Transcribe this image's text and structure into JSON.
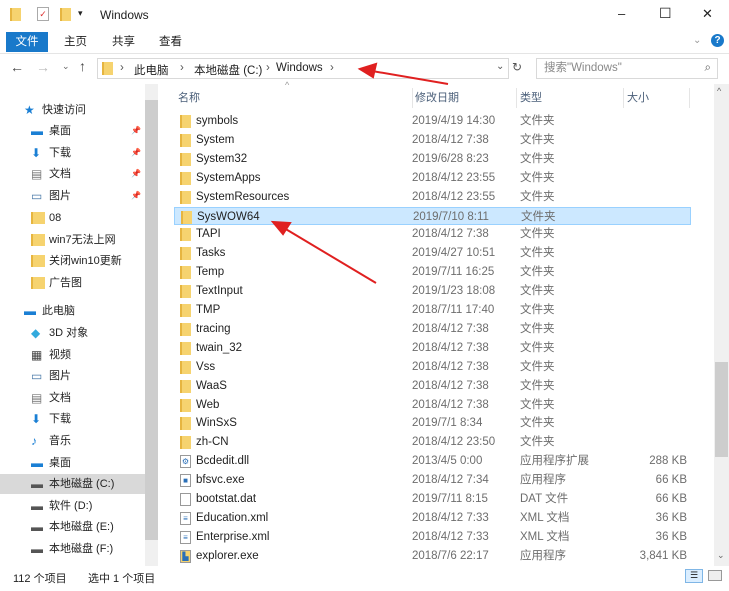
{
  "window": {
    "title": "Windows",
    "minimize": "–",
    "maximize": "☐",
    "close": "✕"
  },
  "ribbon": {
    "tabs": [
      "文件",
      "主页",
      "共享",
      "查看"
    ],
    "help": "?"
  },
  "address": {
    "crumbs": [
      "此电脑",
      "本地磁盘 (C:)",
      "Windows"
    ],
    "search_placeholder": "搜索\"Windows\""
  },
  "columns": {
    "name": "名称",
    "date": "修改日期",
    "type": "类型",
    "size": "大小"
  },
  "sidebar": {
    "quick_access": "快速访问",
    "quick_items": [
      {
        "label": "桌面",
        "icon": "desktop",
        "pinned": true
      },
      {
        "label": "下载",
        "icon": "download",
        "pinned": true
      },
      {
        "label": "文档",
        "icon": "document",
        "pinned": true
      },
      {
        "label": "图片",
        "icon": "picture",
        "pinned": true
      },
      {
        "label": "08",
        "icon": "folder"
      },
      {
        "label": "win7无法上网",
        "icon": "folder"
      },
      {
        "label": "关闭win10更新",
        "icon": "folder"
      },
      {
        "label": "广告图",
        "icon": "folder"
      }
    ],
    "this_pc": "此电脑",
    "pc_items": [
      {
        "label": "3D 对象",
        "icon": "3d"
      },
      {
        "label": "视频",
        "icon": "video"
      },
      {
        "label": "图片",
        "icon": "picture"
      },
      {
        "label": "文档",
        "icon": "document"
      },
      {
        "label": "下载",
        "icon": "download"
      },
      {
        "label": "音乐",
        "icon": "music"
      },
      {
        "label": "桌面",
        "icon": "desktop"
      },
      {
        "label": "本地磁盘 (C:)",
        "icon": "drive",
        "selected": true
      },
      {
        "label": "软件 (D:)",
        "icon": "drive"
      },
      {
        "label": "本地磁盘 (E:)",
        "icon": "drive"
      },
      {
        "label": "本地磁盘 (F:)",
        "icon": "drive"
      }
    ]
  },
  "files": [
    {
      "name": "symbols",
      "date": "2019/4/19 14:30",
      "type": "文件夹",
      "size": "",
      "icon": "folder"
    },
    {
      "name": "System",
      "date": "2018/4/12 7:38",
      "type": "文件夹",
      "size": "",
      "icon": "folder"
    },
    {
      "name": "System32",
      "date": "2019/6/28 8:23",
      "type": "文件夹",
      "size": "",
      "icon": "folder"
    },
    {
      "name": "SystemApps",
      "date": "2018/4/12 23:55",
      "type": "文件夹",
      "size": "",
      "icon": "folder"
    },
    {
      "name": "SystemResources",
      "date": "2018/4/12 23:55",
      "type": "文件夹",
      "size": "",
      "icon": "folder"
    },
    {
      "name": "SysWOW64",
      "date": "2019/7/10 8:11",
      "type": "文件夹",
      "size": "",
      "icon": "folder",
      "selected": true
    },
    {
      "name": "TAPI",
      "date": "2018/4/12 7:38",
      "type": "文件夹",
      "size": "",
      "icon": "folder"
    },
    {
      "name": "Tasks",
      "date": "2019/4/27 10:51",
      "type": "文件夹",
      "size": "",
      "icon": "folder"
    },
    {
      "name": "Temp",
      "date": "2019/7/11 16:25",
      "type": "文件夹",
      "size": "",
      "icon": "folder"
    },
    {
      "name": "TextInput",
      "date": "2019/1/23 18:08",
      "type": "文件夹",
      "size": "",
      "icon": "folder"
    },
    {
      "name": "TMP",
      "date": "2018/7/11 17:40",
      "type": "文件夹",
      "size": "",
      "icon": "folder"
    },
    {
      "name": "tracing",
      "date": "2018/4/12 7:38",
      "type": "文件夹",
      "size": "",
      "icon": "folder"
    },
    {
      "name": "twain_32",
      "date": "2018/4/12 7:38",
      "type": "文件夹",
      "size": "",
      "icon": "folder"
    },
    {
      "name": "Vss",
      "date": "2018/4/12 7:38",
      "type": "文件夹",
      "size": "",
      "icon": "folder"
    },
    {
      "name": "WaaS",
      "date": "2018/4/12 7:38",
      "type": "文件夹",
      "size": "",
      "icon": "folder"
    },
    {
      "name": "Web",
      "date": "2018/4/12 7:38",
      "type": "文件夹",
      "size": "",
      "icon": "folder"
    },
    {
      "name": "WinSxS",
      "date": "2019/7/1 8:34",
      "type": "文件夹",
      "size": "",
      "icon": "folder"
    },
    {
      "name": "zh-CN",
      "date": "2018/4/12 23:50",
      "type": "文件夹",
      "size": "",
      "icon": "folder"
    },
    {
      "name": "Bcdedit.dll",
      "date": "2013/4/5 0:00",
      "type": "应用程序扩展",
      "size": "288 KB",
      "icon": "dll"
    },
    {
      "name": "bfsvc.exe",
      "date": "2018/4/12 7:34",
      "type": "应用程序",
      "size": "66 KB",
      "icon": "exe"
    },
    {
      "name": "bootstat.dat",
      "date": "2019/7/11 8:15",
      "type": "DAT 文件",
      "size": "66 KB",
      "icon": "file"
    },
    {
      "name": "Education.xml",
      "date": "2018/4/12 7:33",
      "type": "XML 文档",
      "size": "36 KB",
      "icon": "xml"
    },
    {
      "name": "Enterprise.xml",
      "date": "2018/4/12 7:33",
      "type": "XML 文档",
      "size": "36 KB",
      "icon": "xml"
    },
    {
      "name": "explorer.exe",
      "date": "2018/7/6 22:17",
      "type": "应用程序",
      "size": "3,841 KB",
      "icon": "explorer"
    }
  ],
  "status": {
    "count": "112 个项目",
    "selected": "选中 1 个项目"
  },
  "colors": {
    "accent": "#1979ca",
    "selection": "#cce8ff",
    "arrow": "#e02020"
  }
}
